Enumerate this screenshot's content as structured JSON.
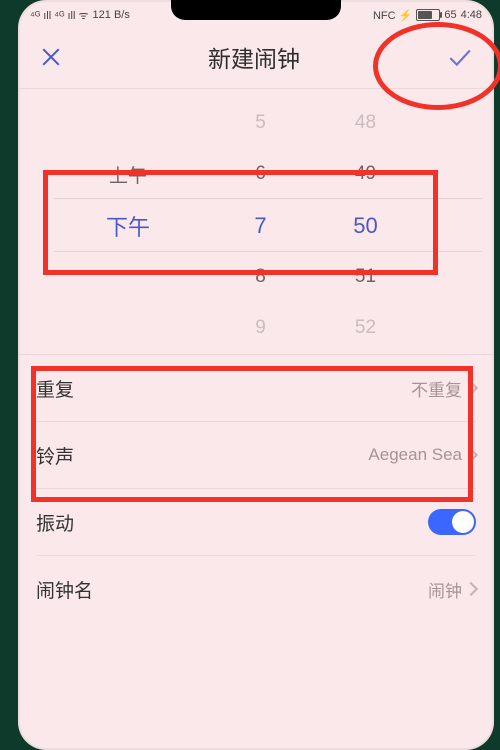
{
  "status": {
    "signal_text": "⁴ᴳ ıll ⁴ᴳ ıll  ᯤ",
    "speed": "121 B/s",
    "nfc": "NFC ⚡",
    "battery_pct": "65",
    "time": "4:48"
  },
  "header": {
    "title": "新建闹钟"
  },
  "picker": {
    "ampm": {
      "prev": "上午",
      "sel": "下午"
    },
    "hour": {
      "m2": "5",
      "m1": "6",
      "sel": "7",
      "p1": "8",
      "p2": "9"
    },
    "min": {
      "m2": "48",
      "m1": "49",
      "sel": "50",
      "p1": "51",
      "p2": "52"
    }
  },
  "settings": {
    "repeat": {
      "label": "重复",
      "value": "不重复"
    },
    "ringtone": {
      "label": "铃声",
      "value": "Aegean Sea"
    },
    "vibrate": {
      "label": "振动"
    },
    "name": {
      "label": "闹钟名",
      "value": "闹钟"
    }
  }
}
